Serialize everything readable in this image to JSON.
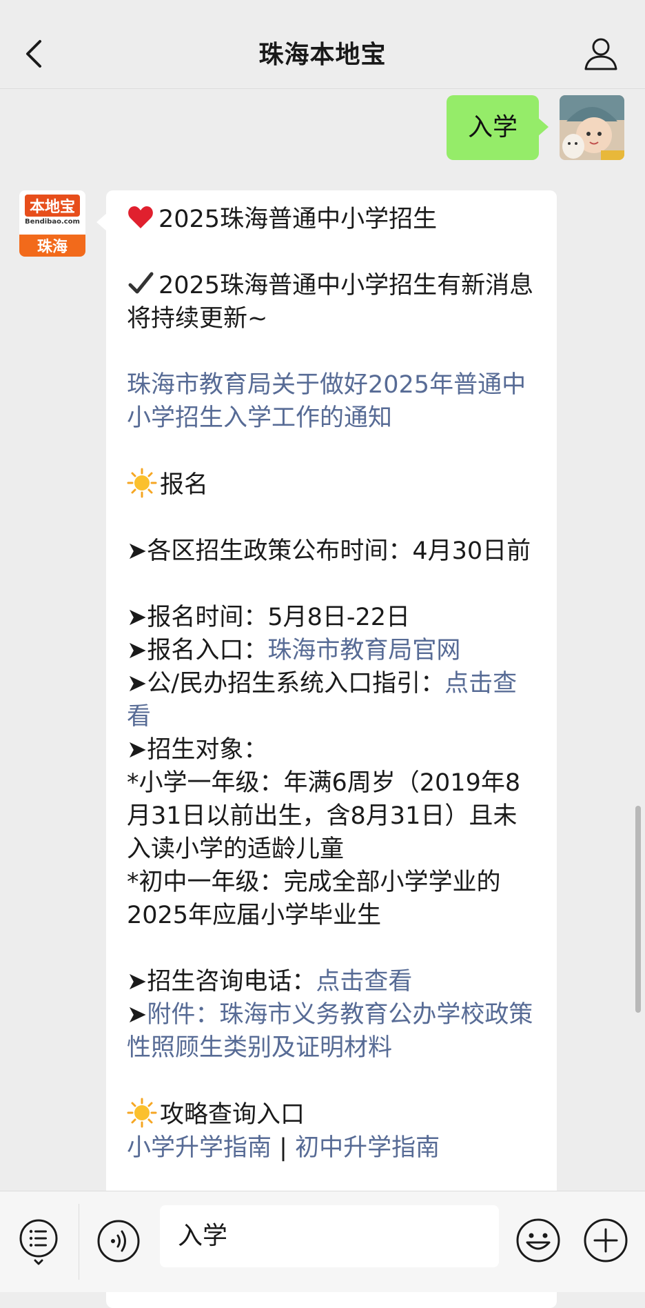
{
  "header": {
    "title": "珠海本地宝"
  },
  "messages": {
    "user_text": "入学",
    "bot_avatar": {
      "brand": "本地宝",
      "url": "Bendibao.com",
      "city": "珠海"
    },
    "bot": {
      "heading": "2025珠海普通中小学招生",
      "update_note": "2025珠海普通中小学招生有新消息将持续更新~",
      "notice_link": "珠海市教育局关于做好2025年普通中小学招生入学工作的通知",
      "section_register": "报名",
      "publish_time": "➤各区招生政策公布时间：4月30日前",
      "register_time": "➤报名时间：5月8日-22日",
      "register_entry_label": "➤报名入口：",
      "register_entry_link": "珠海市教育局官网",
      "system_guide_label": "➤公/民办招生系统入口指引：",
      "system_guide_link": "点击查看",
      "target_label": "➤招生对象：",
      "target_primary": "*小学一年级：年满6周岁（2019年8月31日以前出生，含8月31日）且未入读小学的适龄儿童",
      "target_middle": "*初中一年级：完成全部小学学业的2025年应届小学毕业生",
      "hotline_label": "➤招生咨询电话：",
      "hotline_link": "点击查看",
      "attachment_label": "➤",
      "attachment_link": "附件：珠海市义务教育公办学校政策性照顾生类别及证明材料",
      "section_guide": "攻略查询入口",
      "guide_primary": "小学升学指南",
      "guide_sep": " | ",
      "guide_middle": "初中升学指南"
    }
  },
  "input": {
    "value": "入学"
  },
  "icons": {
    "back": "chevron-left-icon",
    "profile": "person-icon",
    "menu": "menu-list-icon",
    "voice": "voice-icon",
    "emoji": "emoji-icon",
    "plus": "plus-icon"
  },
  "colors": {
    "user_bubble": "#95ec69",
    "link": "#576b95",
    "brand_orange": "#f26a1b"
  }
}
